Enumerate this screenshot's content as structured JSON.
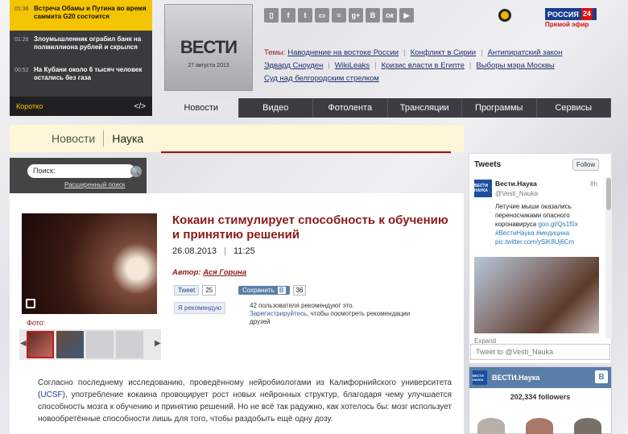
{
  "ticker": {
    "items": [
      {
        "time": "01:36",
        "text": "Встреча Обамы и Путина во время саммита G20 состоится",
        "highlight": true
      },
      {
        "time": "01:26",
        "text": "Злоумышленник ограбил банк на полмиллиона рублей и скрылся",
        "highlight": false
      },
      {
        "time": "00:52",
        "text": "На Кубани около 6 тысяч человек остались без газа",
        "highlight": false
      }
    ],
    "footer_label": "Коротко",
    "footer_link": "</>"
  },
  "logo": {
    "wordmark": "ВЕСТИ",
    "date": "27 августа 2013"
  },
  "social_icons": [
    "phone-icon",
    "facebook-icon",
    "twitter-icon",
    "podcast-icon",
    "rss-icon",
    "googleplus-icon",
    "vk-icon",
    "odnoklassniki-icon",
    "youtube-icon"
  ],
  "social_glyphs": [
    "▯",
    "f",
    "t",
    "▭",
    "≈",
    "g+",
    "В",
    "ок",
    "▶"
  ],
  "channel": {
    "name": "РОССИЯ",
    "number": "24",
    "live": "Прямой эфир"
  },
  "topics": {
    "label": "Темы:",
    "items": [
      "Наводнение на востоке России",
      "Конфликт в Сирии",
      "Антипиратский закон",
      "Эдвард Сноуден",
      "WikiLeaks",
      "Кризис власти в Египте",
      "Выборы мэра Москвы",
      "Суд над белгородским стрелком"
    ]
  },
  "nav": [
    "Новости",
    "Видео",
    "Фотолента",
    "Трансляции",
    "Программы",
    "Сервисы"
  ],
  "breadcrumb": {
    "section": "Новости",
    "subsection": "Наука"
  },
  "search": {
    "placeholder": "Поиск:",
    "button": "🔍",
    "advanced": "Расширенный поиск"
  },
  "article": {
    "title": "Кокаин стимулирует способность к обучению и принятию решений",
    "date": "26.08.2013",
    "time": "11:25",
    "author_label": "Автор:",
    "author": "Ася Горина",
    "photo_label": "Фото:",
    "body_1": "Согласно последнему исследованию, проведённому нейробиологами из Калифорнийского университета (",
    "body_link": "UCSF",
    "body_2": "), употребление кокаина провоцирует рост новых нейронных структур, благодаря чему улучшается способность мозга к обучению и принятию решений. Но не всё так радужно, как хотелось бы: мозг использует новообретённые способности лишь для того, чтобы раздобыть ещё одну дозу."
  },
  "share": {
    "tweet": "Tweet",
    "tweet_count": "25",
    "save": "Сохранить",
    "vk": "В",
    "save_count": "36",
    "fb_like": "Я рекомендую",
    "fb_text": "42 пользователя рекомендуют это.",
    "fb_register": "Зарегистрируйтесь",
    "fb_text2": ", чтобы посмотреть рекомендации друзей"
  },
  "twitter": {
    "header": "Tweets",
    "follow": "Follow",
    "user": "Вести.Наука",
    "avatar_text": "ВЕСТИ НАУКА",
    "handle": "@Vesti_Nauka",
    "time": "8h",
    "text": "Летучие мыши оказались переносчиками опасного коронавируса",
    "link": "goo.gl/Qs1f0x",
    "tags": "#ВестиНаука #медицина",
    "pic": "pic.twitter.com/ySiK8Uj6Cm",
    "expand": "Expand",
    "input_placeholder": "Tweet to @Vesti_Nauka"
  },
  "vk_widget": {
    "name": "ВЕСТИ.Наука",
    "avatar_text": "ВЕСТИ НАУКА",
    "logo": "В",
    "followers": "202,334 followers"
  }
}
